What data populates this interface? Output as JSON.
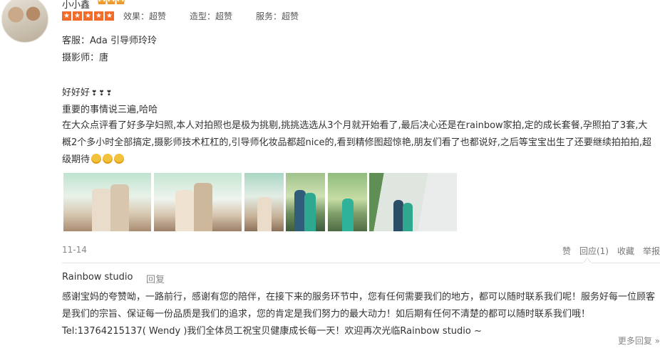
{
  "review": {
    "username": "小小鑫",
    "stars": [
      "★",
      "★",
      "★",
      "★",
      "★"
    ],
    "ratings": [
      {
        "label": "效果：超赞"
      },
      {
        "label": "造型：超赞"
      },
      {
        "label": "服务：超赞"
      }
    ],
    "service_line": "客服：Ada 引导师玲玲",
    "photographer_line": "摄影师：唐",
    "line1": "好好好",
    "line1_icons": [
      "❣",
      "❣",
      "❣"
    ],
    "line2": "重要的事情说三遍,哈哈",
    "body": "在大众点评看了好多孕妇照,本人对拍照也是极为挑剔,挑挑选选从3个月就开始看了,最后决心还是在rainbow家拍,定的成长套餐,孕照拍了3套,大概2个多小时全部搞定,摄影师技术杠杠的,引导师化妆品都超nice的,看到精修图超惊艳,朋友们看了也都说好,之后等宝宝出生了还要继续拍拍拍,超级期待",
    "date": "11-14",
    "actions": {
      "like": "赞",
      "reply": "回应(1)",
      "favorite": "收藏",
      "report": "举报"
    }
  },
  "reply": {
    "name": "Rainbow studio",
    "reply_button": "回复",
    "text": "感谢宝妈的夸赞呦，一路前行，感谢有您的陪伴，在接下来的服务环节中，您有任何需要我们的地方，都可以随时联系我们呢！服务好每一位顾客是我们的宗旨、保证每一份品质是我们的追求，您的肯定是我们努力的最大动力！如后期有任何不清楚的都可以随时联系我们哦！Tel:13764215137( Wendy )我们全体员工祝宝贝健康成长每一天！欢迎再次光临Rainbow studio ~",
    "more": "更多回复 »"
  },
  "colors": {
    "accent": "#f26b2a",
    "muted": "#888888"
  }
}
